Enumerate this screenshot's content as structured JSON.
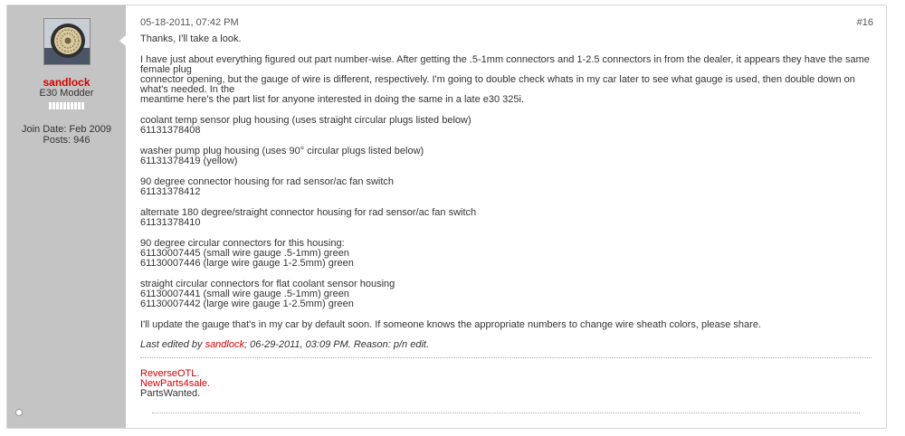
{
  "post": {
    "date": "05-18-2011, 07:42 PM",
    "number": "#16",
    "user": {
      "name": "sandlock",
      "title": "E30 Modder",
      "join_date": "Join Date: Feb 2009",
      "posts": "Posts: 946",
      "reputation_bars": 10,
      "online_status": "offline"
    },
    "message": {
      "p1": "Thanks, I'll take a look.",
      "p2": [
        "I have just about everything figured out part number-wise. After getting the .5-1mm connectors and 1-2.5 connectors in from the dealer, it appears they have the same female plug",
        "connector opening, but the gauge of wire is different, respectively. I'm going to double check whats in my car later to see what gauge is used, then double down on what's needed. In the",
        "meantime here's the part list for anyone interested in doing the same in a late e30 325i."
      ],
      "p3": [
        "coolant temp sensor plug housing (uses straight circular plugs listed below)",
        "61131378408"
      ],
      "p4": [
        "washer pump plug housing (uses 90° circular plugs listed below)",
        "61131378419 (yellow)"
      ],
      "p5": [
        "90 degree connector housing for rad sensor/ac fan switch",
        "61131378412"
      ],
      "p6": [
        "alternate 180 degree/straight connector housing for rad sensor/ac fan switch",
        "61131378410"
      ],
      "p7": [
        "90 degree circular connectors for this housing:",
        "61130007445 (small wire gauge .5-1mm) green",
        "61130007446 (large wire gauge 1-2.5mm) green"
      ],
      "p8": [
        "straight circular connectors for flat coolant sensor housing",
        "61130007441 (small wire gauge .5-1mm) green",
        "61130007442 (large wire gauge 1-2.5mm) green"
      ],
      "p9": "I'll update the gauge that's in my car by default soon. If someone knows the appropriate numbers to change wire sheath colors, please share."
    },
    "edited": {
      "prefix": "Last edited by ",
      "user": "sandlock",
      "suffix": "; 06-29-2011, 03:09 PM. Reason: p/n edit."
    },
    "signature": {
      "link1": "ReverseOTL.",
      "link2": "NewParts4sale.",
      "text3": "PartsWanted."
    }
  },
  "colors": {
    "sidebar_bg": "#c4c4c4",
    "username": "#d40000",
    "link": "#d40000",
    "text": "#333333"
  }
}
